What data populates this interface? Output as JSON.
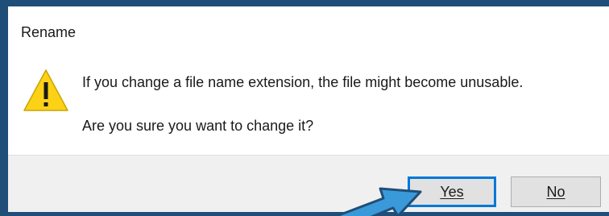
{
  "dialog": {
    "title": "Rename",
    "icon": "warning-icon",
    "message": "If you change a file name extension, the file might become unusable.",
    "question": "Are you sure you want to change it?"
  },
  "buttons": {
    "yes_label": "Yes",
    "no_label": "No"
  },
  "colors": {
    "frame": "#1f4e79",
    "warning_fill": "#fcd116",
    "focus_border": "#0078d7",
    "annotation_arrow": "#3a9ad9"
  }
}
